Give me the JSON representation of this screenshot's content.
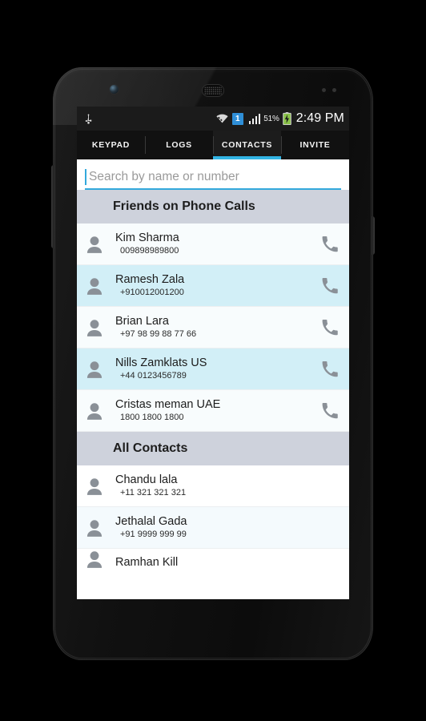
{
  "status_bar": {
    "usb_icon": "usb-icon",
    "wifi_icon": "wifi-icon",
    "sim_badge": "1",
    "signal_icon": "signal-bars-icon",
    "battery_percent": "51%",
    "battery_icon": "battery-charging-icon",
    "clock": "2:49 PM"
  },
  "tabs": [
    {
      "label": "KEYPAD",
      "active": false
    },
    {
      "label": "LOGS",
      "active": false
    },
    {
      "label": "CONTACTS",
      "active": true
    },
    {
      "label": "INVITE",
      "active": false
    }
  ],
  "search": {
    "value": "",
    "placeholder": "Search by name or number"
  },
  "sections": [
    {
      "title": "Friends on Phone Calls",
      "has_call_action": true,
      "contacts": [
        {
          "name": "Kim Sharma",
          "number": "009898989800",
          "call_icon": "phone-call-icon"
        },
        {
          "name": "Ramesh Zala",
          "number": "+910012001200",
          "call_icon": "phone-call-icon"
        },
        {
          "name": "Brian Lara",
          "number": "+97 98 99 88 77 66",
          "call_icon": "phone-call-icon"
        },
        {
          "name": "Nills Zamklats US",
          "number": "+44 0123456789",
          "call_icon": "phone-call-icon"
        },
        {
          "name": "Cristas meman UAE",
          "number": "1800 1800 1800",
          "call_icon": "phone-call-icon"
        }
      ]
    },
    {
      "title": "All Contacts",
      "has_call_action": false,
      "contacts": [
        {
          "name": "Chandu lala",
          "number": "+11 321 321 321"
        },
        {
          "name": "Jethalal Gada",
          "number": "+91 9999 999 99"
        },
        {
          "name": "Ramhan Kill",
          "number": ""
        }
      ]
    }
  ],
  "colors": {
    "accent": "#33b5e5",
    "section_header_bg": "#ced2dc",
    "row_highlight": "#d2eff7",
    "sim_badge_bg": "#2f8fd8",
    "battery_green": "#8bc34a"
  },
  "device": {
    "camera_icon": "front-camera-icon",
    "earpiece_icon": "earpiece-speaker-icon",
    "sensor_icon": "proximity-sensor-icon",
    "volume_button": "volume-rocker-button",
    "power_button": "power-button"
  }
}
